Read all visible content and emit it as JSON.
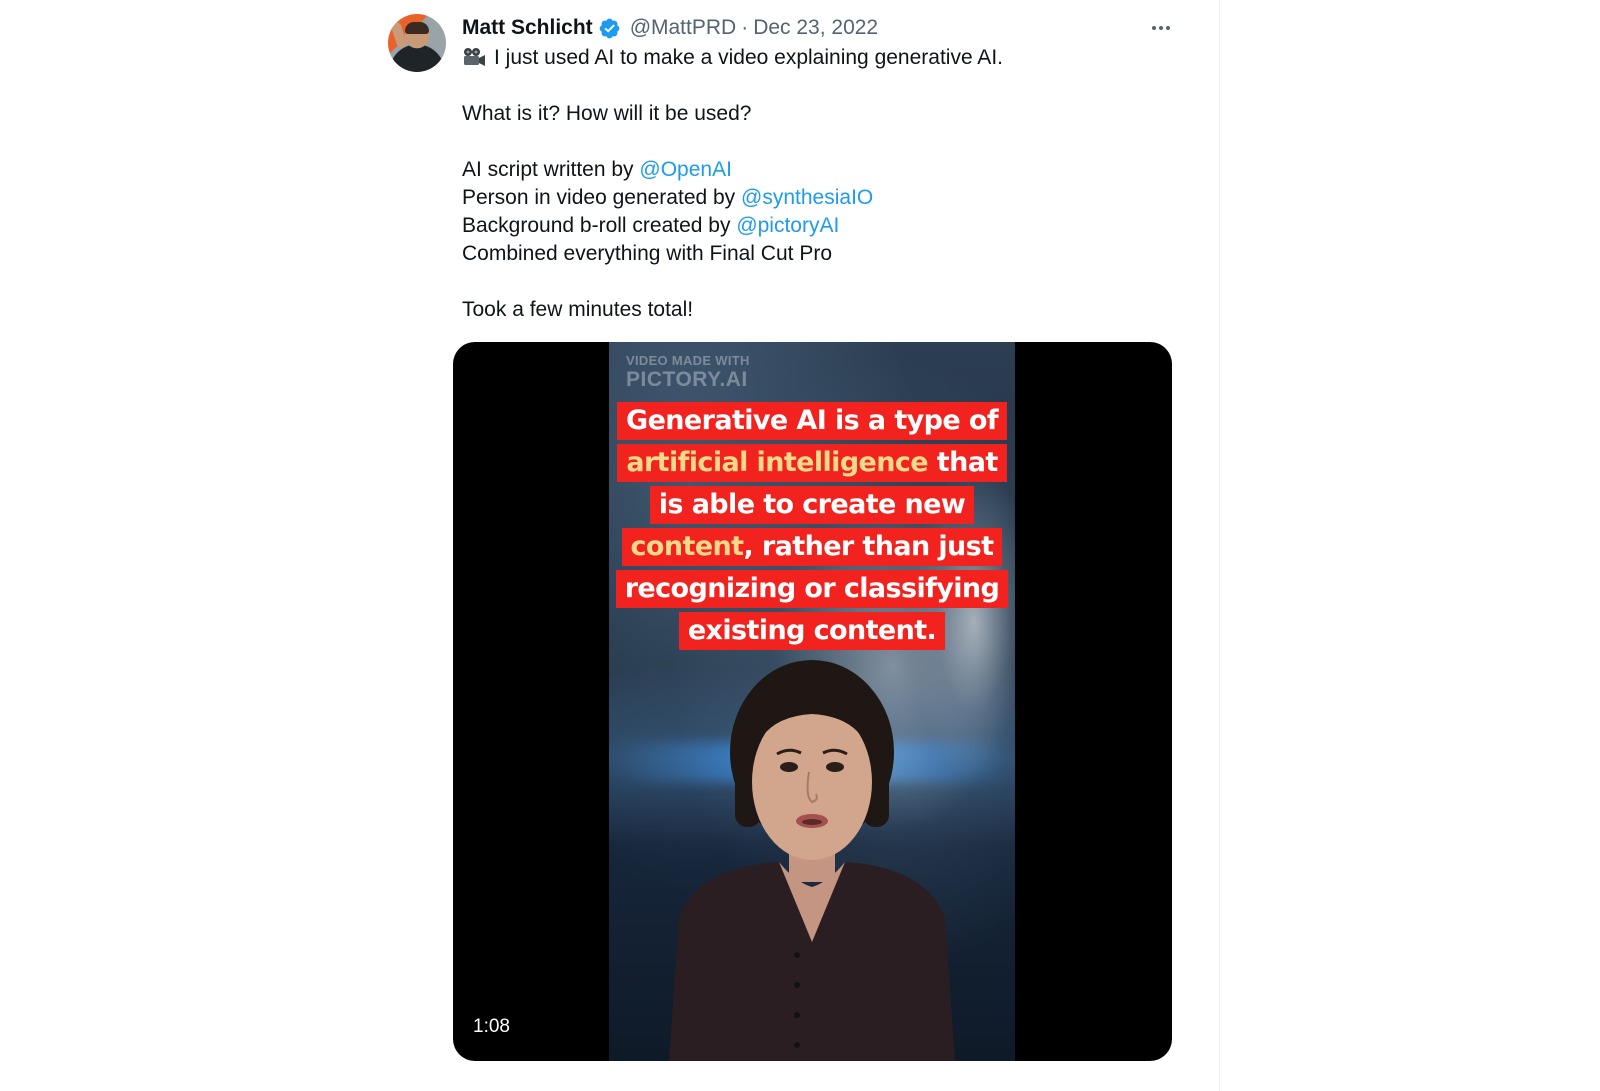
{
  "author": {
    "name": "Matt Schlicht",
    "handle": "@MattPRD",
    "separator": "·",
    "date": "Dec 23, 2022"
  },
  "tweet": {
    "line1": "I just used AI to make a video explaining generative AI.",
    "line2": "What is it? How will it be used?",
    "line3_prefix": "AI script written by ",
    "line3_mention": "@OpenAI",
    "line4_prefix": "Person in video generated by ",
    "line4_mention": "@synthesiaIO",
    "line5_prefix": "Background b-roll created by ",
    "line5_mention": "@pictoryAI",
    "line6": "Combined everything with Final Cut Pro",
    "line7": "Took a few minutes total!"
  },
  "media": {
    "watermark_line1": "VIDEO MADE WITH",
    "watermark_line2": "PICTORY.AI",
    "caption": {
      "l1": "Generative AI is a type of",
      "l2_hl": "artificial intelligence",
      "l2_rest": " that",
      "l3": "is able to create new",
      "l4_hl": "content",
      "l4_rest": ", rather than just",
      "l5": "recognizing or classifying",
      "l6": "existing content."
    },
    "duration": "1:08"
  },
  "icons": {
    "verified": "verified-badge-icon",
    "more": "more-options-icon",
    "emoji": "film-projector-icon"
  },
  "colors": {
    "mention": "#1d9bf0",
    "secondary_text": "#536471",
    "caption_bg": "#f2231f",
    "caption_highlight": "#f8d98a"
  }
}
